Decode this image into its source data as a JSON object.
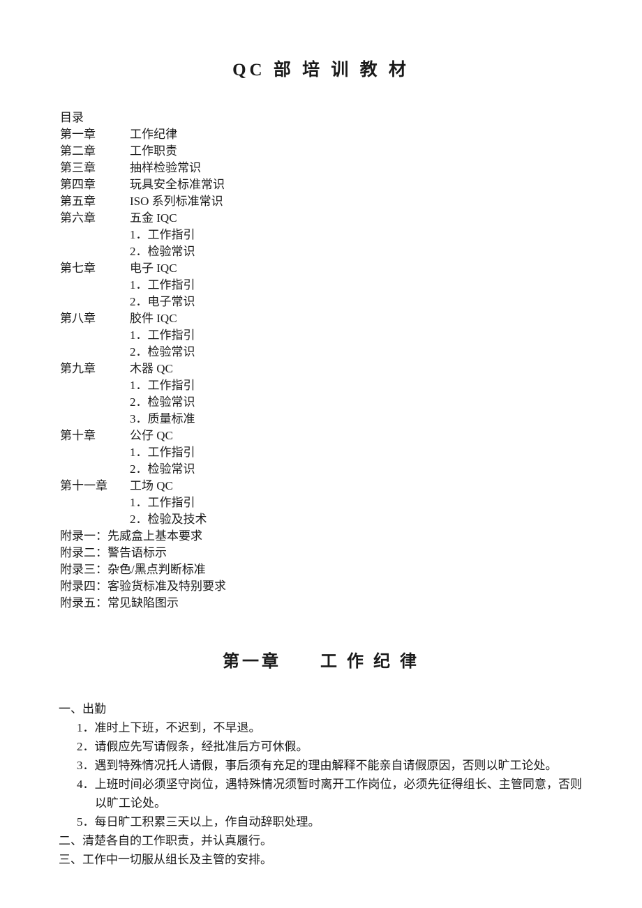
{
  "document": {
    "title": "QC 部 培 训 教 材",
    "toc_heading": "目录"
  },
  "toc": {
    "chapters": [
      {
        "label": "第一章",
        "title": "工作纪律",
        "subitems": []
      },
      {
        "label": "第二章",
        "title": "工作职责",
        "subitems": []
      },
      {
        "label": "第三章",
        "title": "抽样检验常识",
        "subitems": []
      },
      {
        "label": "第四章",
        "title": "玩具安全标准常识",
        "subitems": []
      },
      {
        "label": "第五章",
        "title": "ISO 系列标准常识",
        "subitems": []
      },
      {
        "label": "第六章",
        "title": "五金 IQC",
        "subitems": [
          "1．工作指引",
          "2．检验常识"
        ]
      },
      {
        "label": "第七章",
        "title": "电子 IQC",
        "subitems": [
          "1．工作指引",
          "2．电子常识"
        ]
      },
      {
        "label": "第八章",
        "title": "胶件 IQC",
        "subitems": [
          "1．工作指引",
          "2．检验常识"
        ]
      },
      {
        "label": "第九章",
        "title": "木器 QC",
        "subitems": [
          "1．工作指引",
          "2．检验常识",
          "3．质量标准"
        ]
      },
      {
        "label": "第十章",
        "title": "公仔 QC",
        "subitems": [
          "1．工作指引",
          "2．检验常识"
        ]
      },
      {
        "label": "第十一章",
        "title": "工场 QC",
        "subitems": [
          "1．工作指引",
          "2．检验及技术"
        ]
      }
    ],
    "appendices": [
      "附录一：先威盒上基本要求",
      "附录二：警告语标示",
      "附录三：杂色/黑点判断标准",
      "附录四：客验货标准及特别要求",
      "附录五：常见缺陷图示"
    ]
  },
  "chapter1": {
    "heading": "第一章　　工 作 纪 律",
    "sections": [
      {
        "label": "一、出勤",
        "items": [
          "1．准时上下班，不迟到，不早退。",
          "2．请假应先写请假条，经批准后方可休假。",
          "3．遇到特殊情况托人请假，事后须有充足的理由解释不能亲自请假原因，否则以旷工论处。",
          "4．上班时间必须坚守岗位，遇特殊情况须暂时离开工作岗位，必须先征得组长、主管同意，否则以旷工论处。",
          "5．每日旷工积累三天以上，作自动辞职处理。"
        ]
      },
      {
        "label": "二、清楚各自的工作职责，并认真履行。",
        "items": []
      },
      {
        "label": "三、工作中一切服从组长及主管的安排。",
        "items": []
      }
    ]
  }
}
